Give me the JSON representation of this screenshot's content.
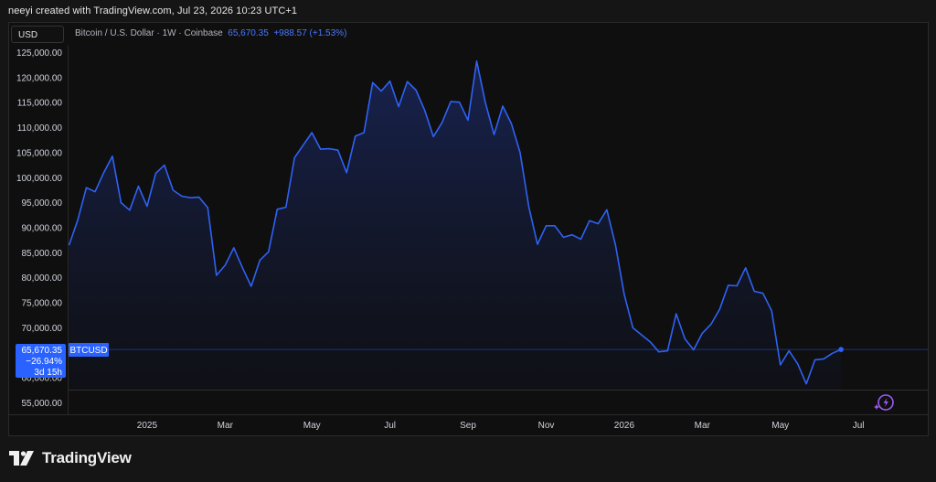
{
  "header": {
    "caption": "neeyi created with TradingView.com, Jul 23, 2026 10:23 UTC+1"
  },
  "toolbar": {
    "currency_label": "USD"
  },
  "legend": {
    "symbol": "Bitcoin / U.S. Dollar · 1W · Coinbase",
    "price": "65,670.35",
    "change": "+988.57 (+1.53%)"
  },
  "price_tag": {
    "price": "65,670.35",
    "change_pct": "−26.94%",
    "countdown": "3d 15h",
    "symbol_label": "BTCUSD"
  },
  "brand": {
    "name": "TradingView"
  },
  "colors": {
    "line": "#2f62f5",
    "accent": "#2962ff",
    "background": "#0f0f0f"
  },
  "icons": {
    "brand_logo": "tradingview-logo-icon",
    "assistant": "sparkle-bolt-icon"
  },
  "chart_data": {
    "type": "area",
    "title": "Bitcoin / U.S. Dollar · 1W · Coinbase",
    "xlabel": "",
    "ylabel": "",
    "ylim": [
      53000,
      126500
    ],
    "y_ticks": [
      55000,
      60000,
      65000,
      70000,
      75000,
      80000,
      85000,
      90000,
      95000,
      100000,
      105000,
      110000,
      115000,
      120000,
      125000
    ],
    "y_tick_labels": [
      "55,000.00",
      "60,000.00",
      "65,000.00",
      "70,000.00",
      "75,000.00",
      "80,000.00",
      "85,000.00",
      "90,000.00",
      "95,000.00",
      "100,000.00",
      "105,000.00",
      "110,000.00",
      "115,000.00",
      "120,000.00",
      "125,000.00"
    ],
    "x_ticks": [
      {
        "label": "2025",
        "index": 9
      },
      {
        "label": "Mar",
        "index": 18
      },
      {
        "label": "May",
        "index": 28
      },
      {
        "label": "Jul",
        "index": 37
      },
      {
        "label": "Sep",
        "index": 46
      },
      {
        "label": "Nov",
        "index": 55
      },
      {
        "label": "2026",
        "index": 64
      },
      {
        "label": "Mar",
        "index": 73
      },
      {
        "label": "May",
        "index": 82
      },
      {
        "label": "Jul",
        "index": 91
      }
    ],
    "x_range": [
      0,
      93
    ],
    "series": [
      {
        "name": "BTCUSD",
        "values": [
          86500,
          91500,
          98000,
          97200,
          101000,
          104300,
          95000,
          93500,
          98300,
          94300,
          100900,
          102500,
          97500,
          96300,
          96000,
          96100,
          94000,
          80500,
          82500,
          86000,
          82000,
          78300,
          83500,
          85200,
          93700,
          94100,
          104000,
          106500,
          109000,
          105700,
          105800,
          105500,
          101000,
          108300,
          109000,
          119000,
          117300,
          119300,
          114200,
          119200,
          117500,
          113500,
          108200,
          111000,
          115200,
          115100,
          111500,
          123300,
          115000,
          108600,
          114300,
          110800,
          105000,
          94200,
          86700,
          90400,
          90400,
          88100,
          88600,
          87700,
          91400,
          90800,
          93600,
          86500,
          76700,
          70000,
          68600,
          67200,
          65200,
          65400,
          72800,
          67800,
          65600,
          68900,
          70700,
          73700,
          78500,
          78400,
          82000,
          77300,
          76900,
          73400,
          62600,
          65400,
          62800,
          58800,
          63600,
          63800,
          64900,
          65670.35
        ]
      }
    ],
    "last_value": 65670.35,
    "grid": false,
    "legend_position": "top-left"
  }
}
